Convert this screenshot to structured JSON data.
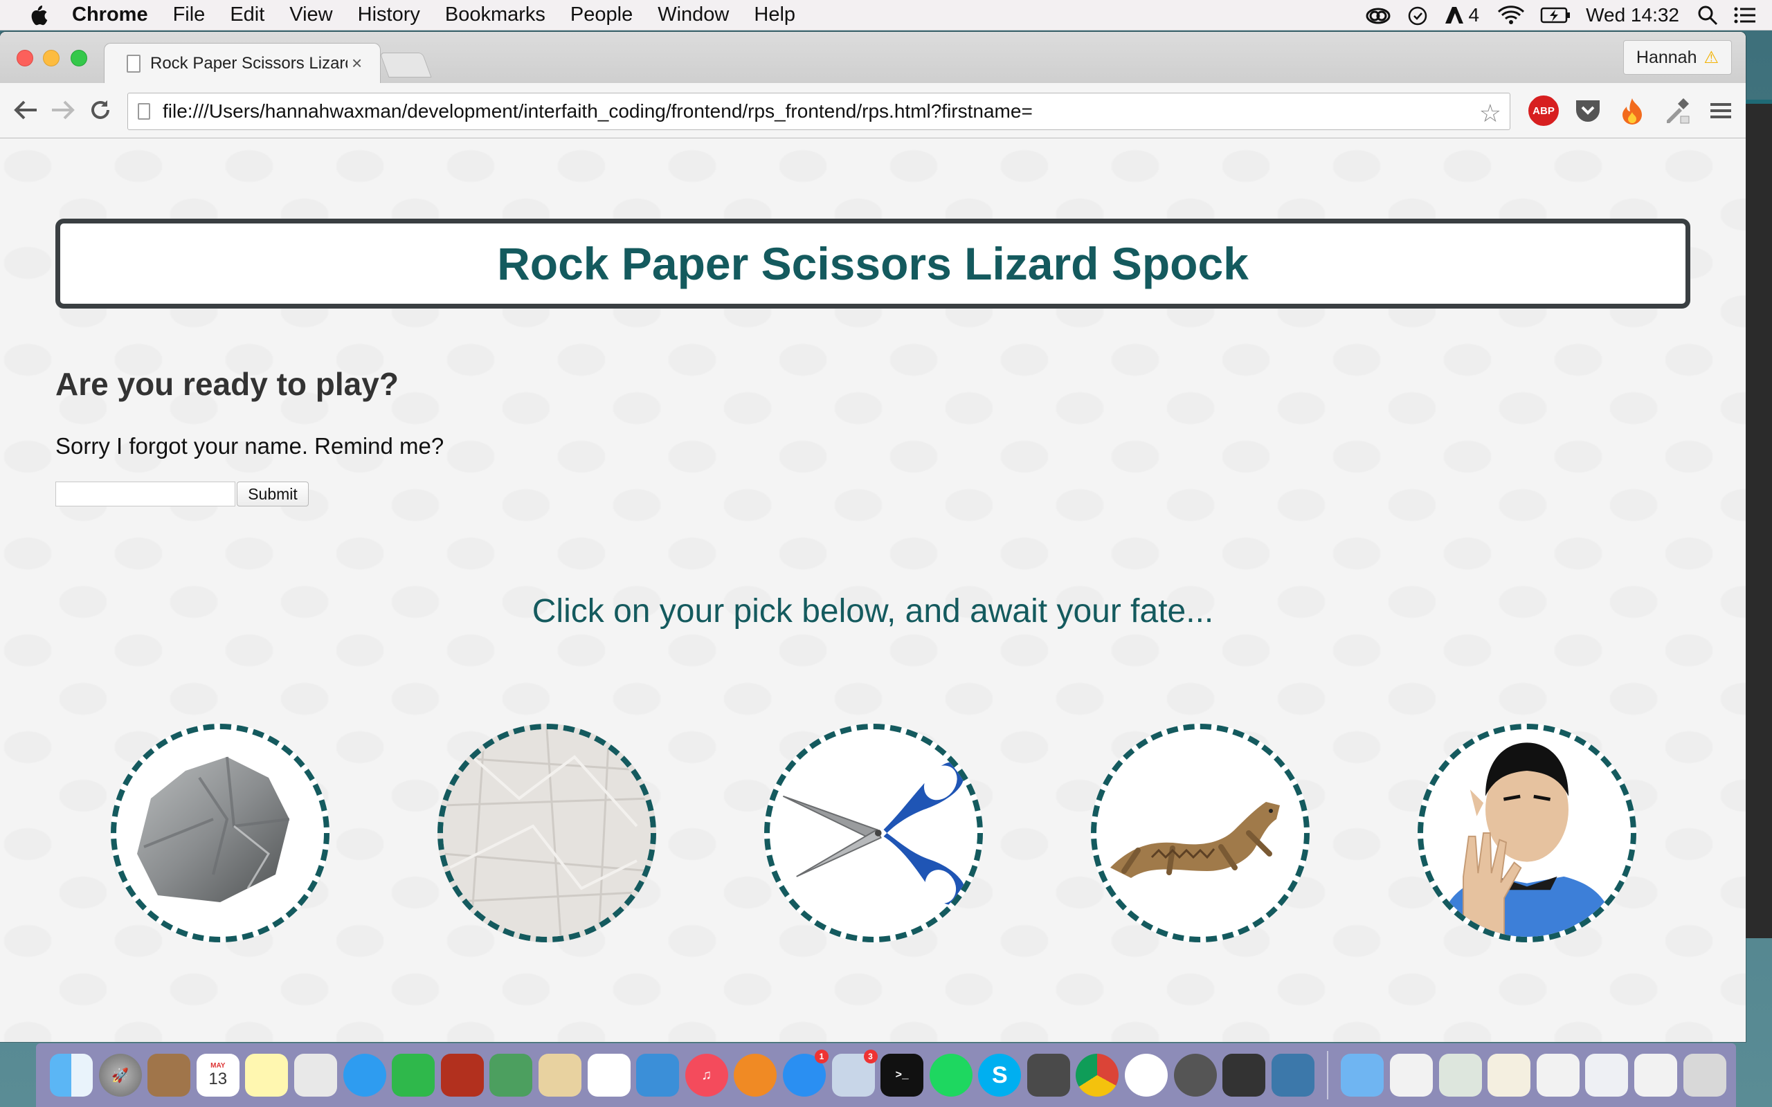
{
  "menubar": {
    "app_name": "Chrome",
    "items": [
      "File",
      "Edit",
      "View",
      "History",
      "Bookmarks",
      "People",
      "Window",
      "Help"
    ],
    "status": {
      "adobe_badge": "4",
      "clock": "Wed 14:32"
    }
  },
  "browser": {
    "tab_title": "Rock Paper Scissors Lizard Spock",
    "tab_close": "×",
    "profile_name": "Hannah",
    "profile_warning": "⚠",
    "url": "file:///Users/hannahwaxman/development/interfaith_coding/frontend/rps_frontend/rps.html?firstname=",
    "abp_label": "ABP"
  },
  "page": {
    "title": "Rock Paper Scissors Lizard Spock",
    "ready_heading": "Are you ready to play?",
    "name_prompt": "Sorry I forgot your name. Remind me?",
    "name_input_value": "",
    "submit_label": "Submit",
    "instruction": "Click on your pick below, and await your fate...",
    "picks": [
      "rock",
      "paper",
      "scissors",
      "lizard",
      "spock"
    ],
    "accent_color": "#145a5e"
  },
  "dock": {
    "calendar_month": "MAY",
    "calendar_day": "13",
    "appstore_badge": "1",
    "mail_badge": "3"
  }
}
